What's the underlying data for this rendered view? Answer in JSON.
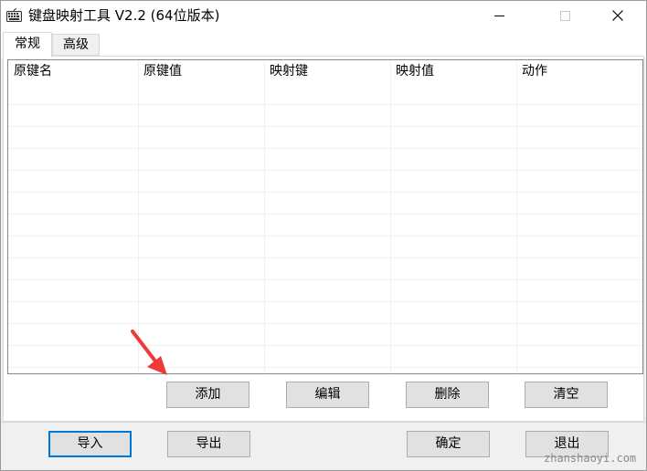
{
  "window": {
    "title": "键盘映射工具 V2.2 (64位版本)"
  },
  "tabs": [
    {
      "label": "常规",
      "active": true
    },
    {
      "label": "高级",
      "active": false
    }
  ],
  "list": {
    "columns": [
      "原键名",
      "原键值",
      "映射键",
      "映射值",
      "动作"
    ],
    "rows": []
  },
  "list_buttons": {
    "add": "添加",
    "edit": "编辑",
    "delete": "删除",
    "clear": "清空"
  },
  "footer_buttons": {
    "import": "导入",
    "export": "导出",
    "ok": "确定",
    "exit": "退出"
  },
  "watermark": "zhanshaoyi.com",
  "colors": {
    "annotation_arrow": "#f03a3a",
    "default_button_border": "#0078d7"
  }
}
